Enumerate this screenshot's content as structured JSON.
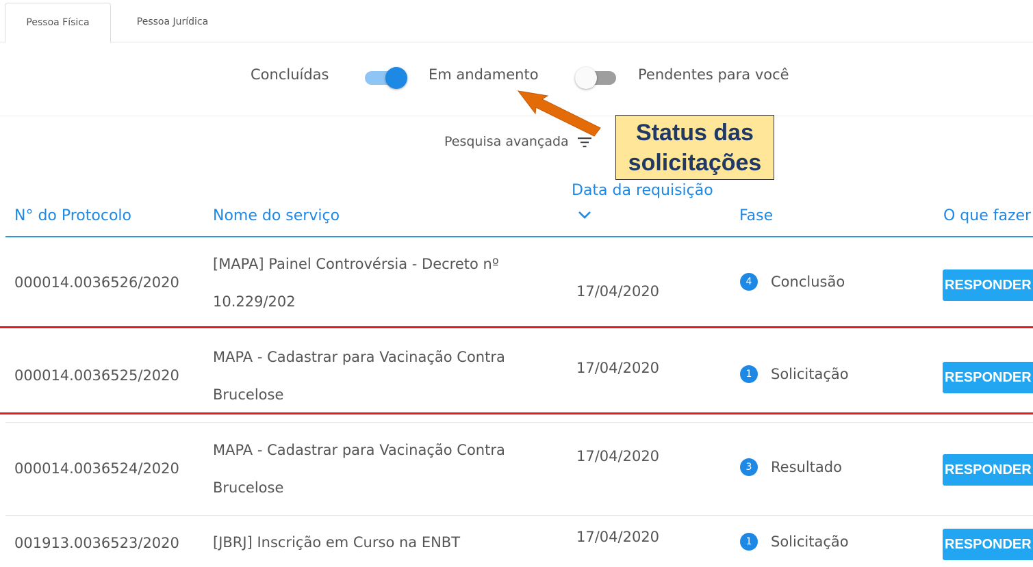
{
  "tabs": [
    {
      "label": "Pessoa Física",
      "active": true
    },
    {
      "label": "Pessoa Jurídica",
      "active": false
    }
  ],
  "toggles": {
    "concluidas_label": "Concluídas",
    "em_andamento_label": "Em andamento",
    "pendentes_label": "Pendentes para você",
    "switch_1_on": true,
    "switch_2_on": false
  },
  "advanced_search": {
    "label": "Pesquisa avançada",
    "icon": "filter-icon"
  },
  "annotation": {
    "line1": "Status das",
    "line2": "solicitações",
    "arrow_color": "#e36c09",
    "box_color": "#ffe699"
  },
  "table": {
    "headers": {
      "protocol": "N° do Protocolo",
      "service": "Nome do serviço",
      "date": "Data da requisição",
      "phase": "Fase",
      "action": "O que fazer"
    },
    "rows": [
      {
        "protocol": "000014.0036526/2020",
        "service": "[MAPA] Painel Controvérsia - Decreto nº 10.229/202",
        "date": "17/04/2020",
        "phase_num": "4",
        "phase": "Conclusão",
        "action": "RESPONDER"
      },
      {
        "protocol": "000014.0036525/2020",
        "service": "MAPA - Cadastrar para Vacinação Contra Brucelose",
        "date": "17/04/2020",
        "phase_num": "1",
        "phase": "Solicitação",
        "action": "RESPONDER"
      },
      {
        "protocol": "000014.0036524/2020",
        "service": "MAPA - Cadastrar para Vacinação Contra Brucelose",
        "date": "17/04/2020",
        "phase_num": "3",
        "phase": "Resultado",
        "action": "RESPONDER"
      },
      {
        "protocol": "001913.0036523/2020",
        "service": "[JBRJ] Inscrição em Curso na ENBT",
        "date": "17/04/2020",
        "phase_num": "1",
        "phase": "Solicitação",
        "action": "RESPONDER"
      }
    ]
  },
  "colors": {
    "accent": "#1e88e5",
    "button": "#22a6f2",
    "highlight": "#e8191b"
  }
}
